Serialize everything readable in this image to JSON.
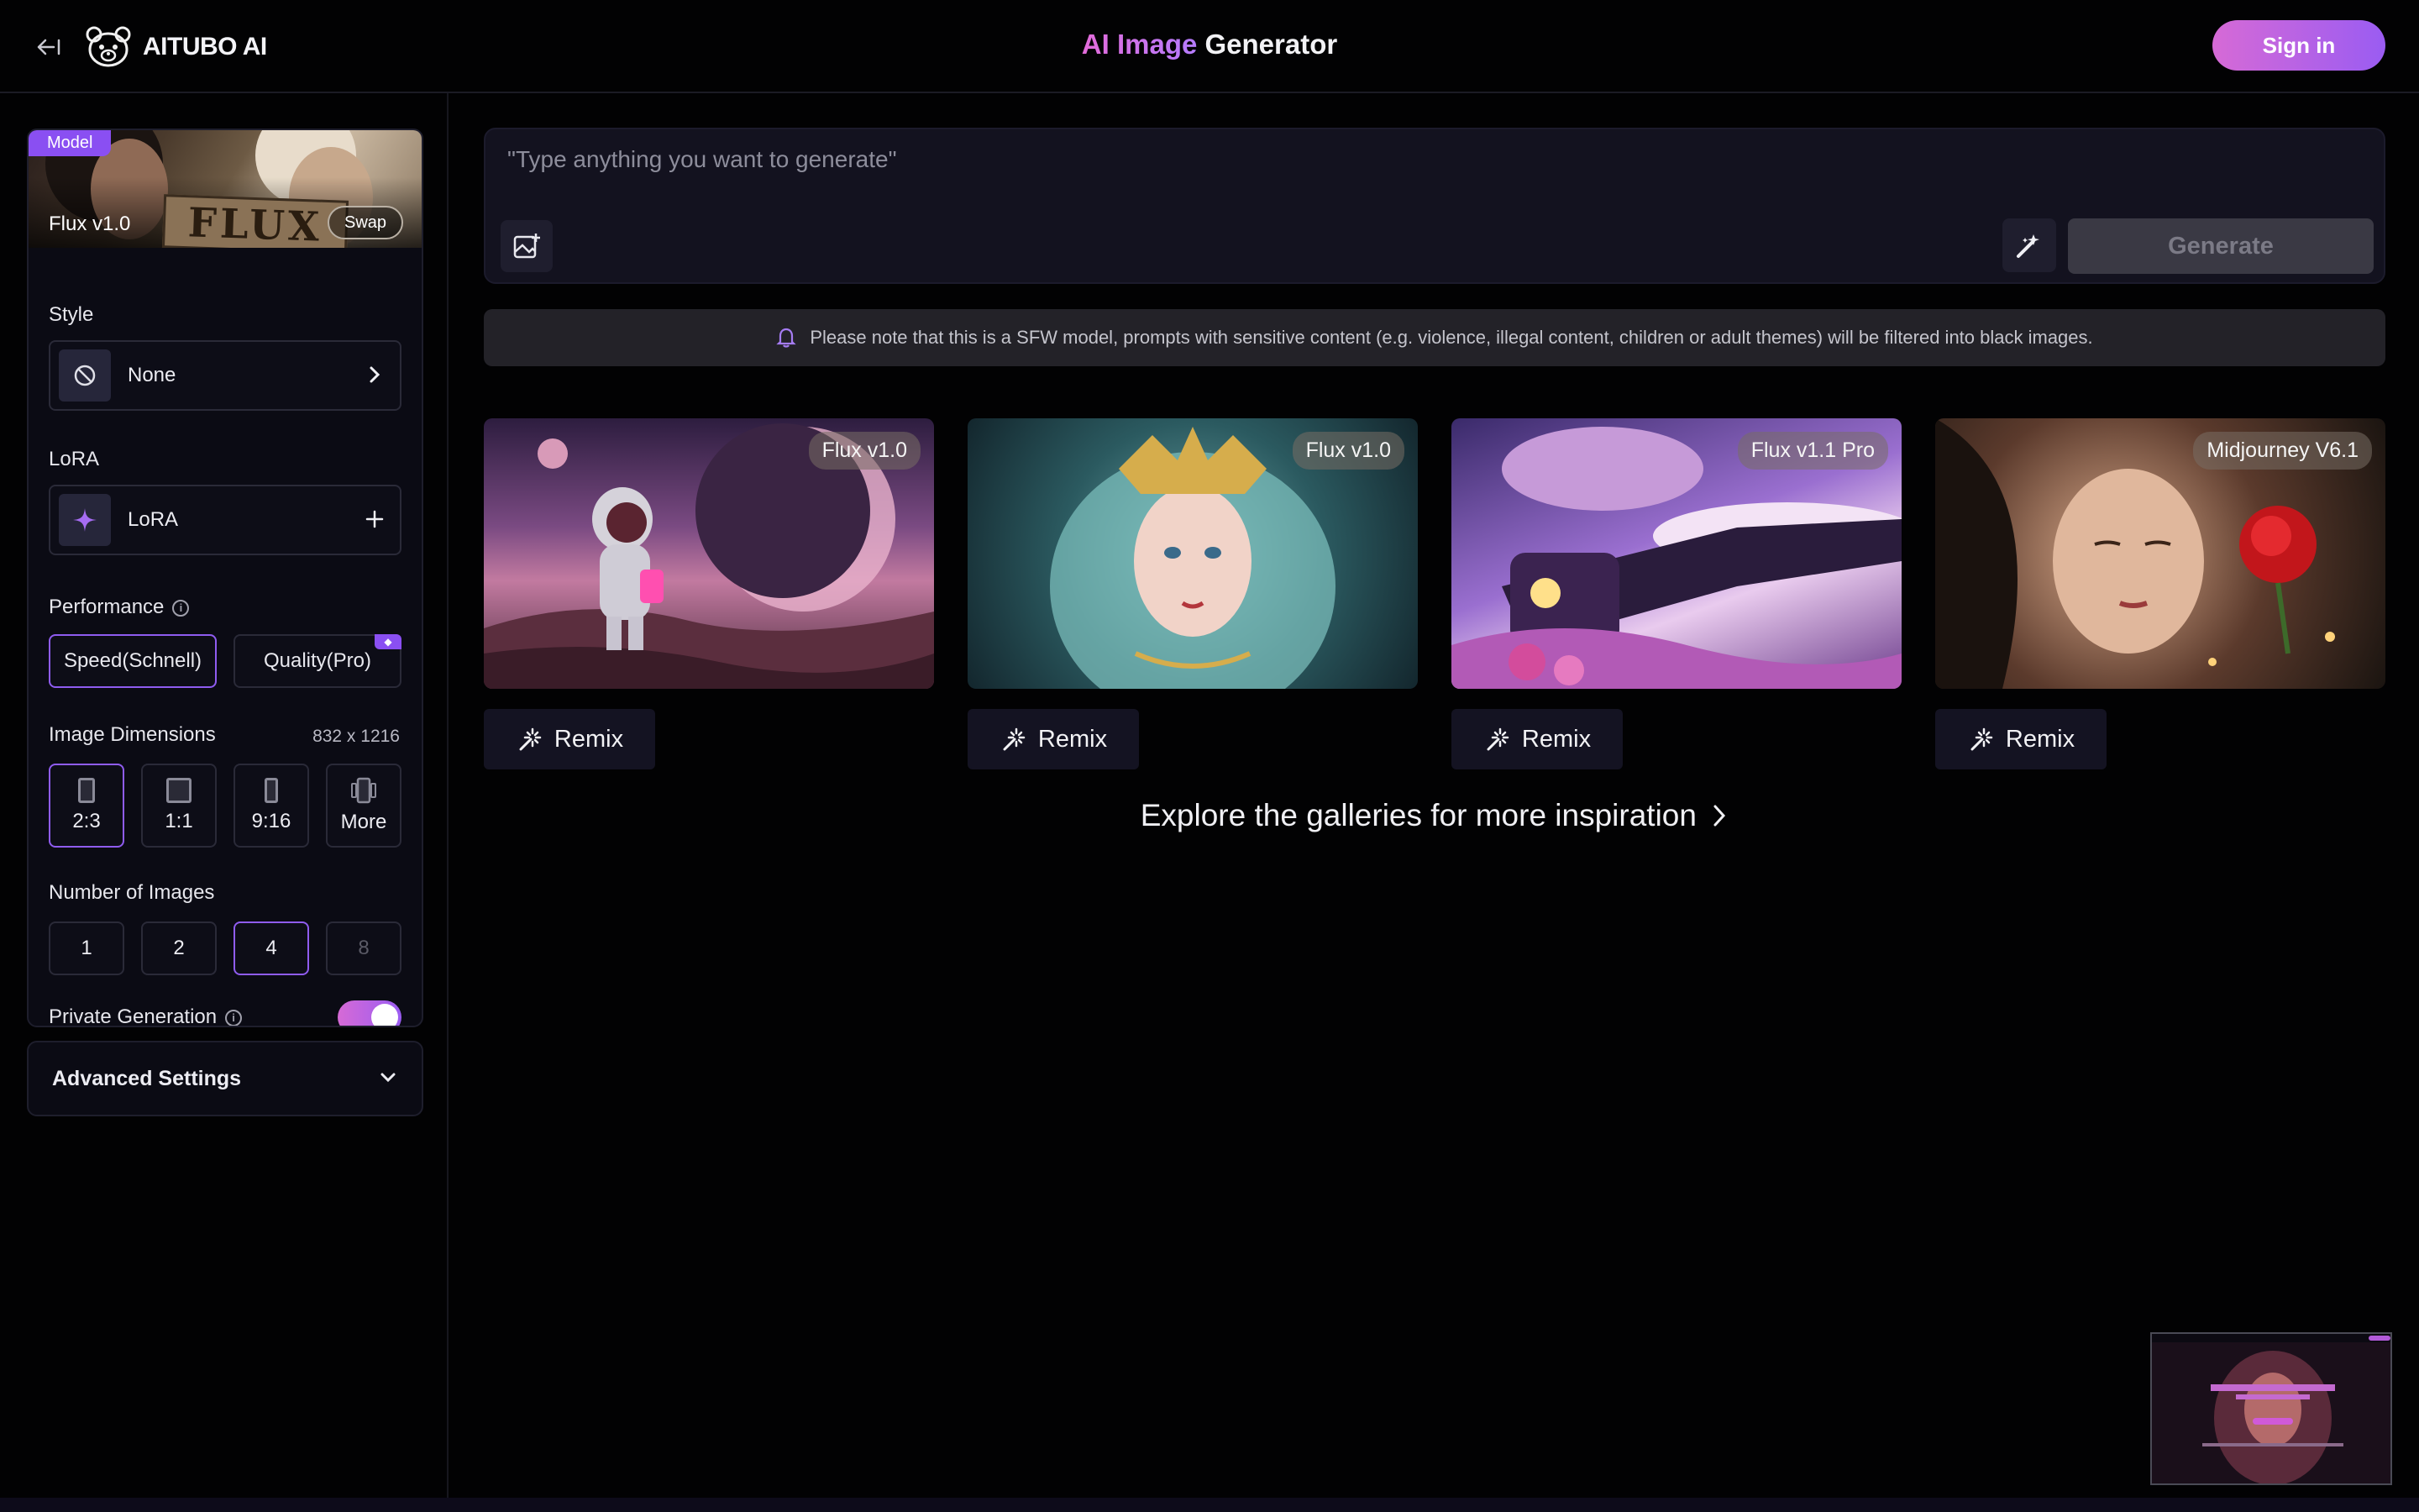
{
  "header": {
    "back_icon": "collapse-left-icon",
    "logo_text": "AITUBO AI",
    "title_accent": "AI Image",
    "title_rest": " Generator",
    "signin_label": "Sign in",
    "accent_colors": [
      "#d66ad6",
      "#9a5cf2"
    ]
  },
  "sidebar": {
    "model": {
      "badge": "Model",
      "name": "Flux v1.0",
      "swap_label": "Swap",
      "thumbnail_sign": "FLUX"
    },
    "style": {
      "label": "Style",
      "value": "None",
      "icon": "ban-icon"
    },
    "lora": {
      "label": "LoRA",
      "value": "LoRA",
      "icon": "sparkle-icon"
    },
    "performance": {
      "label": "Performance",
      "options": [
        {
          "label": "Speed(Schnell)",
          "active": true
        },
        {
          "label": "Quality(Pro)",
          "active": false,
          "pro": true
        }
      ]
    },
    "dimensions": {
      "label": "Image Dimensions",
      "value": "832 x 1216",
      "options": [
        {
          "label": "2:3",
          "active": true
        },
        {
          "label": "1:1",
          "active": false
        },
        {
          "label": "9:16",
          "active": false
        },
        {
          "label": "More",
          "active": false
        }
      ]
    },
    "num_images": {
      "label": "Number of Images",
      "options": [
        {
          "label": "1",
          "state": "normal"
        },
        {
          "label": "2",
          "state": "normal"
        },
        {
          "label": "4",
          "state": "active"
        },
        {
          "label": "8",
          "state": "disabled"
        }
      ]
    },
    "private": {
      "label": "Private Generation",
      "enabled": true
    },
    "advanced": {
      "label": "Advanced Settings"
    }
  },
  "main": {
    "prompt_placeholder": "\"Type anything you want to generate\"",
    "generate_label": "Generate",
    "notice": "Please note that this is a SFW model, prompts with sensitive content (e.g. violence, illegal content, children or adult themes) will be filtered into black images.",
    "cards": [
      {
        "tag": "Flux v1.0",
        "remix": "Remix"
      },
      {
        "tag": "Flux v1.0",
        "remix": "Remix"
      },
      {
        "tag": "Flux v1.1 Pro",
        "remix": "Remix"
      },
      {
        "tag": "Midjourney V6.1",
        "remix": "Remix"
      }
    ],
    "explore": "Explore the galleries for more inspiration"
  }
}
